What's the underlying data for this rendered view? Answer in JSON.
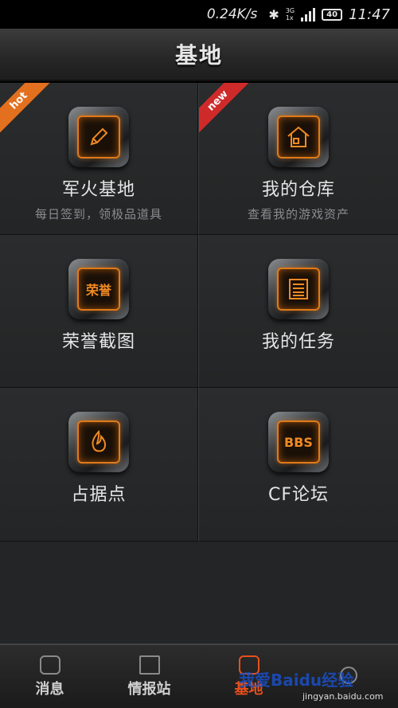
{
  "status": {
    "speed": "0.24K/s",
    "network": [
      "3G",
      "1x"
    ],
    "battery": "40",
    "time": "11:47"
  },
  "header": {
    "title": "基地"
  },
  "tiles": [
    {
      "title": "军火基地",
      "subtitle": "每日签到，领极品道具",
      "badge": "hot",
      "icon": "pencil-icon",
      "icon_text": ""
    },
    {
      "title": "我的仓库",
      "subtitle": "查看我的游戏资产",
      "badge": "new",
      "icon": "house-icon",
      "icon_text": ""
    },
    {
      "title": "荣誉截图",
      "subtitle": "",
      "badge": "",
      "icon": "honor-icon",
      "icon_text": "荣誉"
    },
    {
      "title": "我的任务",
      "subtitle": "",
      "badge": "",
      "icon": "list-icon",
      "icon_text": ""
    },
    {
      "title": "占据点",
      "subtitle": "",
      "badge": "",
      "icon": "flame-icon",
      "icon_text": ""
    },
    {
      "title": "CF论坛",
      "subtitle": "",
      "badge": "",
      "icon": "bbs-icon",
      "icon_text": "BBS"
    }
  ],
  "nav": [
    {
      "label": "消息",
      "icon": "chat-icon"
    },
    {
      "label": "情报站",
      "icon": "news-icon"
    },
    {
      "label": "基地",
      "icon": "base-icon",
      "active": true
    },
    {
      "label": "",
      "icon": "user-icon"
    }
  ],
  "watermark": {
    "text": "我爱Baidu经验",
    "url": "jingyan.baidu.com"
  },
  "colors": {
    "accent": "#e8501a",
    "hot": "#e3701e",
    "new": "#cf2a2a",
    "icon_glow": "#f08a22"
  }
}
